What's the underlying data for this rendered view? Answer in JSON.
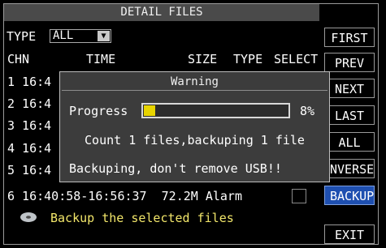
{
  "window": {
    "title": "DETAIL FILES"
  },
  "filter": {
    "label": "TYPE",
    "value": "ALL"
  },
  "columns": {
    "chn": "CHN",
    "time": "TIME",
    "size": "SIZE",
    "type": "TYPE",
    "select": "SELECT"
  },
  "rows": [
    {
      "text": "1 16:4"
    },
    {
      "text": "2 16:4"
    },
    {
      "text": "3 16:4"
    },
    {
      "text": "4 16:4"
    },
    {
      "text": "5 16:4"
    },
    {
      "text": "6 16:40:58-16:56:37  72.2M Alarm"
    }
  ],
  "buttons": {
    "first": "FIRST",
    "prev": "PREV",
    "next": "NEXT",
    "last": "LAST",
    "all": "ALL",
    "inverse": "NVERSE",
    "backup": "BACKUP",
    "exit": "EXIT"
  },
  "dialog": {
    "title": "Warning",
    "progress_label": "Progress",
    "progress_value": 0.08,
    "progress_text": "8%",
    "count_text": "Count 1 files,backuping 1 file",
    "warning_text": "Backuping, don't remove USB!!"
  },
  "footer": {
    "icon": "disc-icon",
    "text": "Backup the selected files"
  },
  "colors": {
    "accent": "#1e4fb0",
    "progress": "#e8d400",
    "hint": "#f2e66a"
  }
}
